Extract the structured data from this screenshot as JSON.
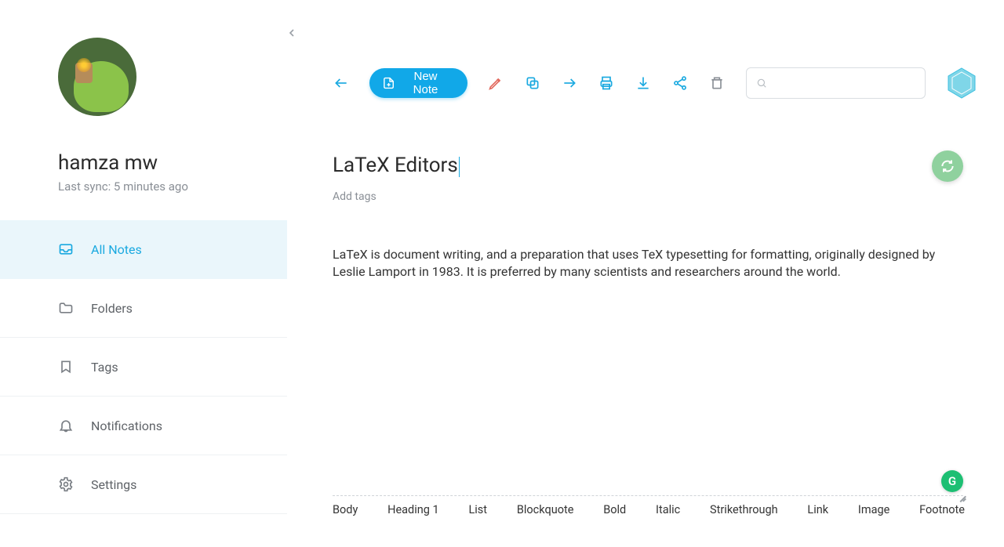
{
  "user": {
    "name": "hamza mw",
    "sync_text": "Last sync: 5 minutes ago"
  },
  "sidebar": {
    "items": [
      {
        "label": "All Notes",
        "icon": "inbox-icon",
        "active": true
      },
      {
        "label": "Folders",
        "icon": "folder-icon",
        "active": false
      },
      {
        "label": "Tags",
        "icon": "bookmark-icon",
        "active": false
      },
      {
        "label": "Notifications",
        "icon": "bell-icon",
        "active": false
      },
      {
        "label": "Settings",
        "icon": "gear-icon",
        "active": false
      }
    ]
  },
  "toolbar": {
    "new_note_label": "New Note",
    "search_placeholder": ""
  },
  "note": {
    "title": "LaTeX Editors",
    "add_tags_label": "Add tags",
    "body": "LaTeX is document writing, and a preparation that uses TeX typesetting for formatting, originally designed by Leslie Lamport in 1983. It is preferred by many scientists and researchers around the world."
  },
  "format_bar": [
    "Body",
    "Heading 1",
    "List",
    "Blockquote",
    "Bold",
    "Italic",
    "Strikethrough",
    "Link",
    "Image",
    "Footnote"
  ],
  "grammarly_badge": "G"
}
